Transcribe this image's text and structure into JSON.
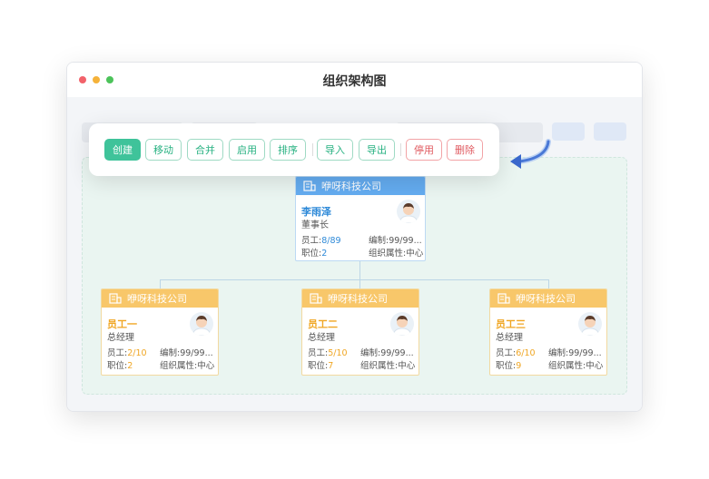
{
  "window": {
    "title": "组织架构图"
  },
  "toolbar": {
    "buttons": [
      "创建",
      "移动",
      "合并",
      "启用",
      "排序",
      "导入",
      "导出",
      "停用",
      "删除"
    ]
  },
  "colors": {
    "accent": "#3fc39a",
    "danger": "#e05a60",
    "root_header": "#64acf0",
    "child_header": "#f8c76a"
  },
  "root": {
    "company": "咿呀科技公司",
    "name": "李雨泽",
    "role": "董事长",
    "staff_label": "员工:",
    "staff_current": "8",
    "staff_total": "/89",
    "quota": "编制:99/99...",
    "position_label": "职位:",
    "position_value": "2",
    "attr": "组织属性:中心"
  },
  "children": [
    {
      "company": "咿呀科技公司",
      "name": "员工一",
      "role": "总经理",
      "staff_label": "员工:",
      "staff_current": "2",
      "staff_total": "/10",
      "quota": "编制:99/99...",
      "position_label": "职位:",
      "position_value": "2",
      "attr": "组织属性:中心"
    },
    {
      "company": "咿呀科技公司",
      "name": "员工二",
      "role": "总经理",
      "staff_label": "员工:",
      "staff_current": "5",
      "staff_total": "/10",
      "quota": "编制:99/99...",
      "position_label": "职位:",
      "position_value": "7",
      "attr": "组织属性:中心"
    },
    {
      "company": "咿呀科技公司",
      "name": "员工三",
      "role": "总经理",
      "staff_label": "员工:",
      "staff_current": "6",
      "staff_total": "/10",
      "quota": "编制:99/99...",
      "position_label": "职位:",
      "position_value": "9",
      "attr": "组织属性:中心"
    }
  ]
}
